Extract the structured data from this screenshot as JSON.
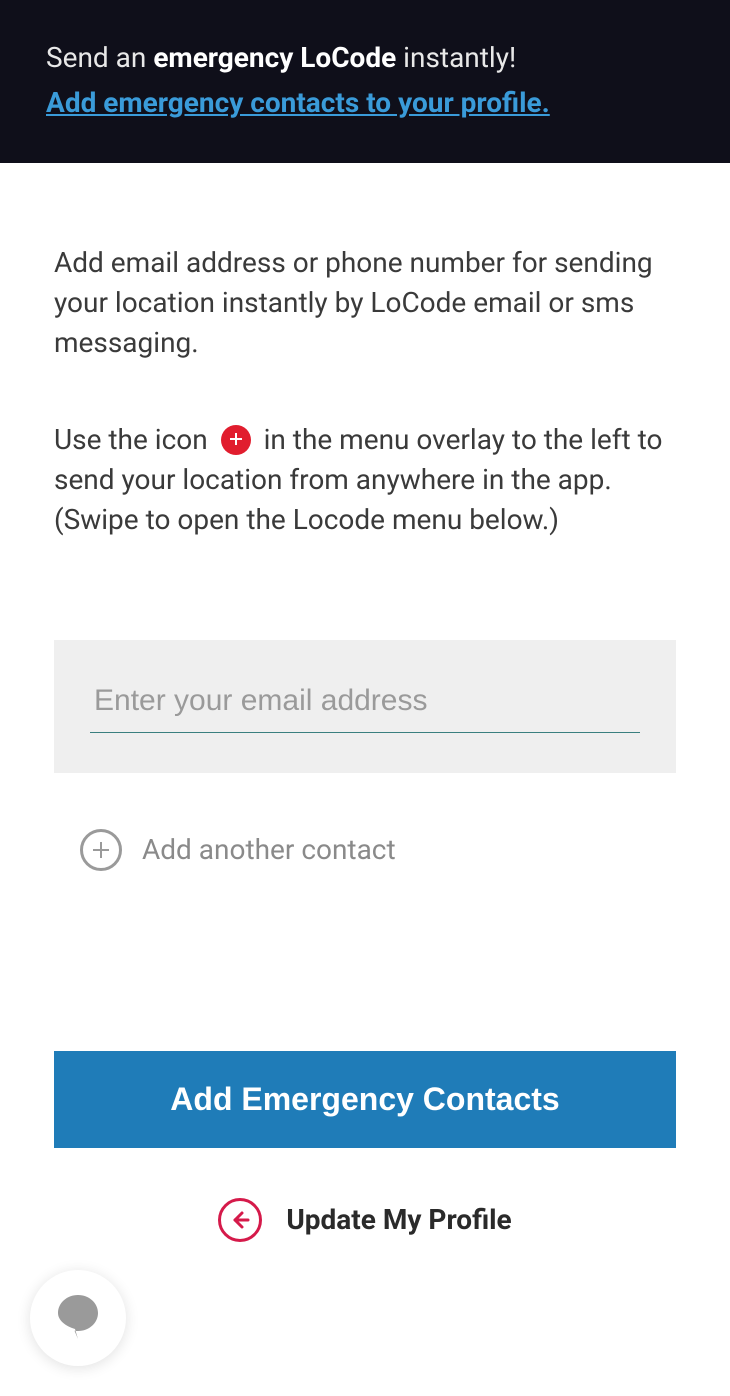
{
  "header": {
    "line1_a": "Send an ",
    "line1_b": "emergency LoCode",
    "line1_c": " instantly!",
    "link": "Add emergency contacts to your profile."
  },
  "intro": {
    "para1": "Add email address or phone number for sending your location instantly by LoCode email or sms messaging.",
    "para2_a": "Use the icon ",
    "para2_b": " in the menu overlay to the left to send your location from anywhere in the app. (Swipe to open the Locode menu below.)"
  },
  "form": {
    "email_placeholder": "Enter your email address",
    "add_another_label": "Add another contact",
    "submit_label": "Add Emergency Contacts"
  },
  "footer": {
    "update_label": "Update My Profile"
  },
  "colors": {
    "accent_red": "#e11d2e",
    "primary_blue": "#1f7cb8",
    "link_blue": "#3a9bd9",
    "back_red": "#d51a4a"
  }
}
